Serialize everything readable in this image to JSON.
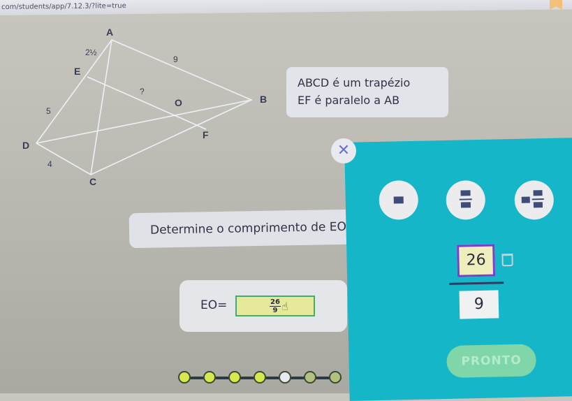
{
  "browser": {
    "url": "com/students/app/7.12.3/?lite=true"
  },
  "geometry": {
    "points": {
      "A": "A",
      "B": "B",
      "C": "C",
      "D": "D",
      "E": "E",
      "F": "F",
      "O": "O"
    },
    "lengths": {
      "ae": "2½",
      "ab": "9",
      "eo": "?",
      "ed": "5",
      "dc": "4"
    }
  },
  "info": {
    "line1": "ABCD é um trapézio",
    "line2": "EF é paralelo a AB"
  },
  "question": {
    "text": "Determine o comprimento de EO."
  },
  "answer": {
    "label": "EO=",
    "numerator": "26",
    "denominator": "9"
  },
  "keypad": {
    "numerator_value": "26",
    "denominator_value": "9",
    "submit_label": "PRONTO",
    "background": "#16b6c9",
    "editor_border": "#7b3fd0"
  },
  "progress": {
    "total_steps": 7,
    "current_step": 5
  }
}
